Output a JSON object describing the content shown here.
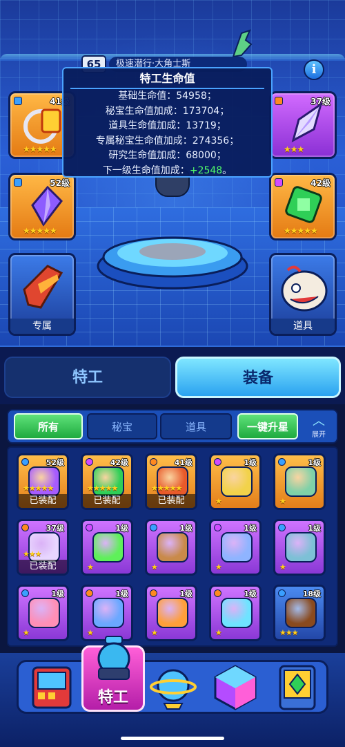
{
  "header": {
    "level": "65",
    "agent_name": "极速潜行·大角士斯",
    "info_icon": "i"
  },
  "tooltip": {
    "title": "特工生命值",
    "rows": [
      "基础生命值：54958；",
      "秘宝生命值加成：173704；",
      "道具生命值加成：13719；",
      "专属秘宝生命值加成：274356；",
      "研究生命值加成：68000；"
    ],
    "next_prefix": "下一级生命值加成：",
    "next_value": "+2548",
    "next_suffix": "。"
  },
  "equip_slots": {
    "left_top": {
      "level": "41级",
      "stars": "★★★★★"
    },
    "left_mid": {
      "level": "52级",
      "stars": "★★★★★"
    },
    "left_bottom": {
      "caption": "专属"
    },
    "right_top": {
      "level": "37级",
      "stars": "★★★"
    },
    "right_mid": {
      "level": "42级",
      "stars": "★★★★★"
    },
    "right_bottom": {
      "caption": "道具"
    }
  },
  "main_tabs": {
    "agent": "特工",
    "equip": "装备"
  },
  "filters": {
    "all": "所有",
    "treasure": "秘宝",
    "item": "道具",
    "upgrade_all": "一键升星",
    "expand": "展开"
  },
  "inventory": [
    {
      "level": "52级",
      "stars": "★★★★★",
      "equipped": "已装配",
      "rarity": "gold",
      "badge": "#3aa0ff",
      "art": "#a65bff"
    },
    {
      "level": "42级",
      "stars": "★★★★★",
      "equipped": "已装配",
      "rarity": "gold",
      "badge": "#d24bff",
      "art": "#2fcf57"
    },
    {
      "level": "41级",
      "stars": "★★★★★",
      "equipped": "已装配",
      "rarity": "gold",
      "badge": "#ff8a1f",
      "art": "#e85a2a"
    },
    {
      "level": "1级",
      "stars": "★",
      "equipped": "",
      "rarity": "gold",
      "badge": "#d24bff",
      "art": "#f2d24a"
    },
    {
      "level": "1级",
      "stars": "★",
      "equipped": "",
      "rarity": "gold",
      "badge": "#3aa0ff",
      "art": "#7fd1a8"
    },
    {
      "level": "37级",
      "stars": "★★★",
      "equipped": "已装配",
      "rarity": "purple",
      "badge": "#ff8a1f",
      "art": "#e8d6ff"
    },
    {
      "level": "1级",
      "stars": "★",
      "equipped": "",
      "rarity": "purple",
      "badge": "#d24bff",
      "art": "#5ff05a"
    },
    {
      "level": "1级",
      "stars": "★",
      "equipped": "",
      "rarity": "purple",
      "badge": "#3aa0ff",
      "art": "#c98a4a"
    },
    {
      "level": "1级",
      "stars": "★",
      "equipped": "",
      "rarity": "purple",
      "badge": "#d24bff",
      "art": "#8fb4ff"
    },
    {
      "level": "1级",
      "stars": "★",
      "equipped": "",
      "rarity": "purple",
      "badge": "#3aa0ff",
      "art": "#7dc0d6"
    },
    {
      "level": "1级",
      "stars": "★",
      "equipped": "",
      "rarity": "purple",
      "badge": "#3aa0ff",
      "art": "#ff8fb6"
    },
    {
      "level": "1级",
      "stars": "★",
      "equipped": "",
      "rarity": "purple",
      "badge": "#ff8a1f",
      "art": "#6ba8ff"
    },
    {
      "level": "1级",
      "stars": "★",
      "equipped": "",
      "rarity": "purple",
      "badge": "#ff8a1f",
      "art": "#ff9f3a"
    },
    {
      "level": "1级",
      "stars": "★",
      "equipped": "",
      "rarity": "purple",
      "badge": "#ff8a1f",
      "art": "#6fe3ff"
    },
    {
      "level": "18级",
      "stars": "★★★",
      "equipped": "",
      "rarity": "blue",
      "badge": "#3aa0ff",
      "art": "#8a4a1e"
    }
  ],
  "bottom_nav": {
    "active_label": "特工",
    "items": [
      "game-console-icon",
      "agent-icon",
      "planet-icon",
      "cube-icon",
      "device-icon"
    ]
  }
}
